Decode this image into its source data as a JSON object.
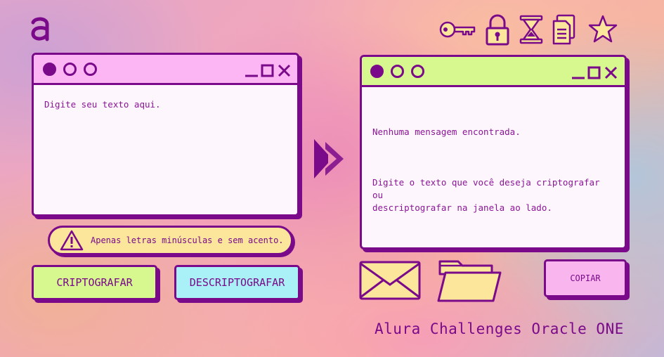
{
  "app": {
    "logo_letter": "a",
    "footer_text": "Alura Challenges Oracle ONE"
  },
  "input_window": {
    "placeholder": "Digite seu texto aqui."
  },
  "output_window": {
    "empty_title": "Nenhuma mensagem encontrada.",
    "empty_message": "Digite o texto que você deseja criptografar ou\ndescriptografar na janela ao lado."
  },
  "warning": {
    "text": "Apenas letras minúsculas e sem acento."
  },
  "buttons": {
    "encrypt_label": "CRIPTOGRAFAR",
    "decrypt_label": "DESCRIPTOGRAFAR",
    "copy_label": "COPIAR"
  },
  "icons": [
    "key-icon",
    "padlock-icon",
    "hourglass-icon",
    "document-icon",
    "star-icon",
    "envelope-icon",
    "folder-icon",
    "arrow-right-icon",
    "warning-icon"
  ],
  "colors": {
    "accent": "#7a0a8a",
    "input_titlebar": "#fbb6f3",
    "output_titlebar": "#d6f88f",
    "encrypt_button": "#d6f88f",
    "decrypt_button": "#a9f1f6",
    "copy_button": "#f9b6ee",
    "warning_bg": "#fbe69c",
    "envelope_folder_fill": "#fbe69c"
  }
}
